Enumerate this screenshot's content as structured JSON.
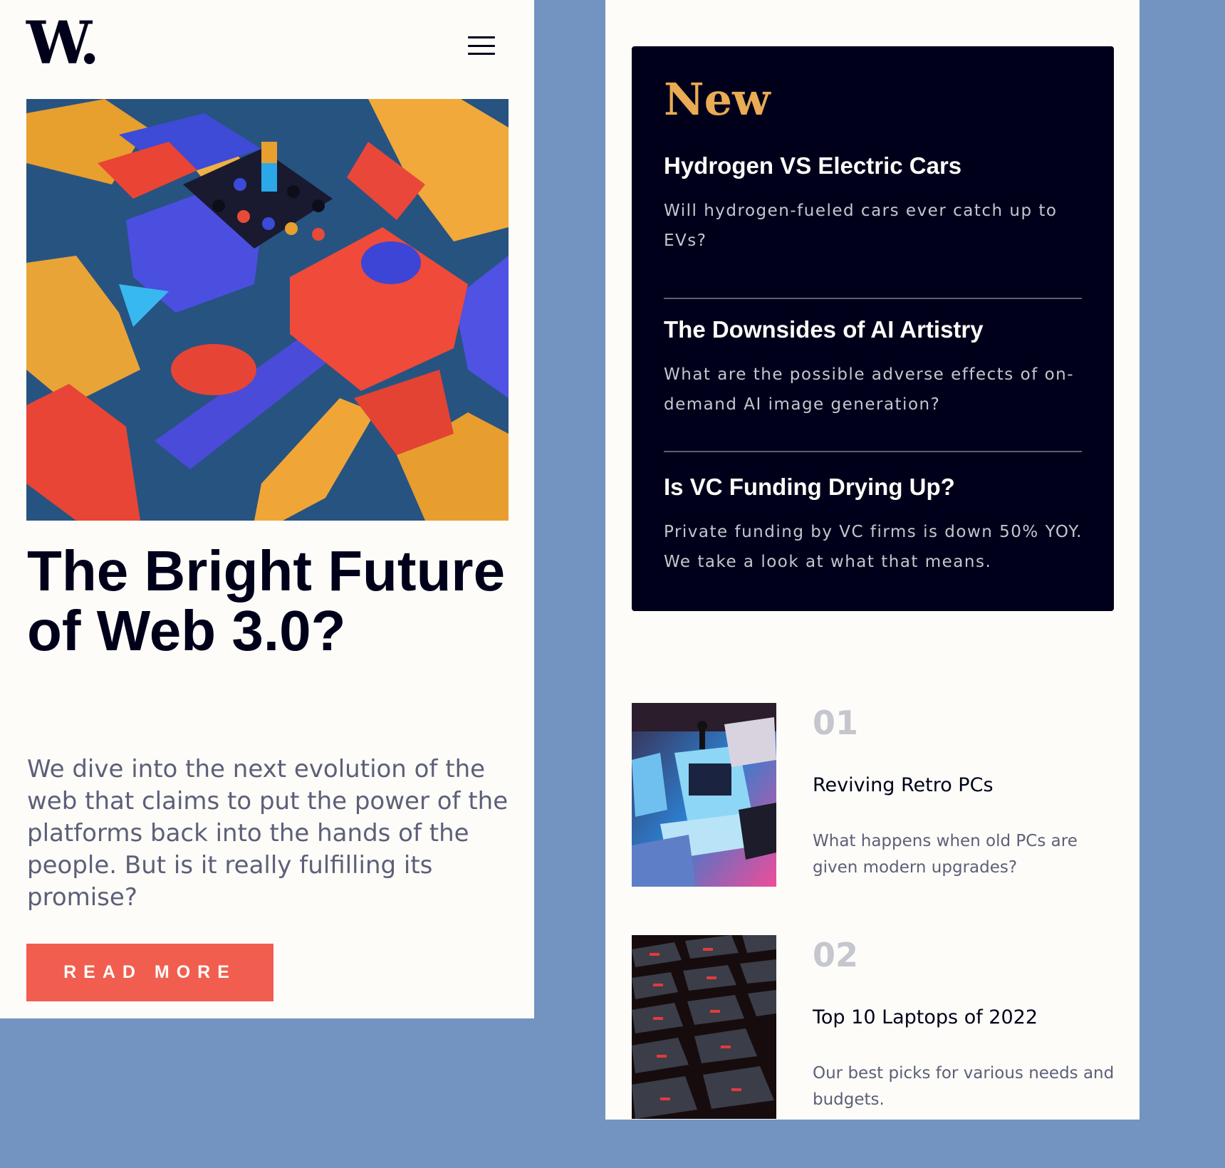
{
  "brand": {
    "logo": "W."
  },
  "colors": {
    "page_bg": "#7393c0",
    "panel_bg": "#fdfcf8",
    "dark": "#00001a",
    "accent_orange": "#e9ab53",
    "accent_red": "#f15e50",
    "muted": "#5d5f79",
    "light_muted": "#c5c6ce"
  },
  "header": {
    "menu_icon": "hamburger-menu-icon"
  },
  "hero": {
    "image": "abstract-3d-blocks-image",
    "title": "The Bright Future of Web 3.0?",
    "description": "We dive into the next evolution of the web that claims to put the power of the platforms back into the hands of the people. But is it really fulfilling its promise?",
    "button_label": "READ MORE"
  },
  "new_section": {
    "heading": "New",
    "items": [
      {
        "title": "Hydrogen VS Electric Cars",
        "description": "Will hydrogen-fueled cars ever catch up to EVs?"
      },
      {
        "title": "The Downsides of AI Artistry",
        "description": "What are the possible adverse effects of on-demand AI image generation?"
      },
      {
        "title": "Is VC Funding Drying Up?",
        "description": "Private funding by VC firms is down 50% YOY. We take a look at what that means."
      }
    ]
  },
  "trending": [
    {
      "number": "01",
      "title": "Reviving Retro PCs",
      "description": "What happens when old PCs are given modern upgrades?",
      "image": "retro-pcs-image"
    },
    {
      "number": "02",
      "title": "Top 10 Laptops of 2022",
      "description": "Our best picks for various needs and budgets.",
      "image": "laptop-keyboard-image"
    }
  ]
}
